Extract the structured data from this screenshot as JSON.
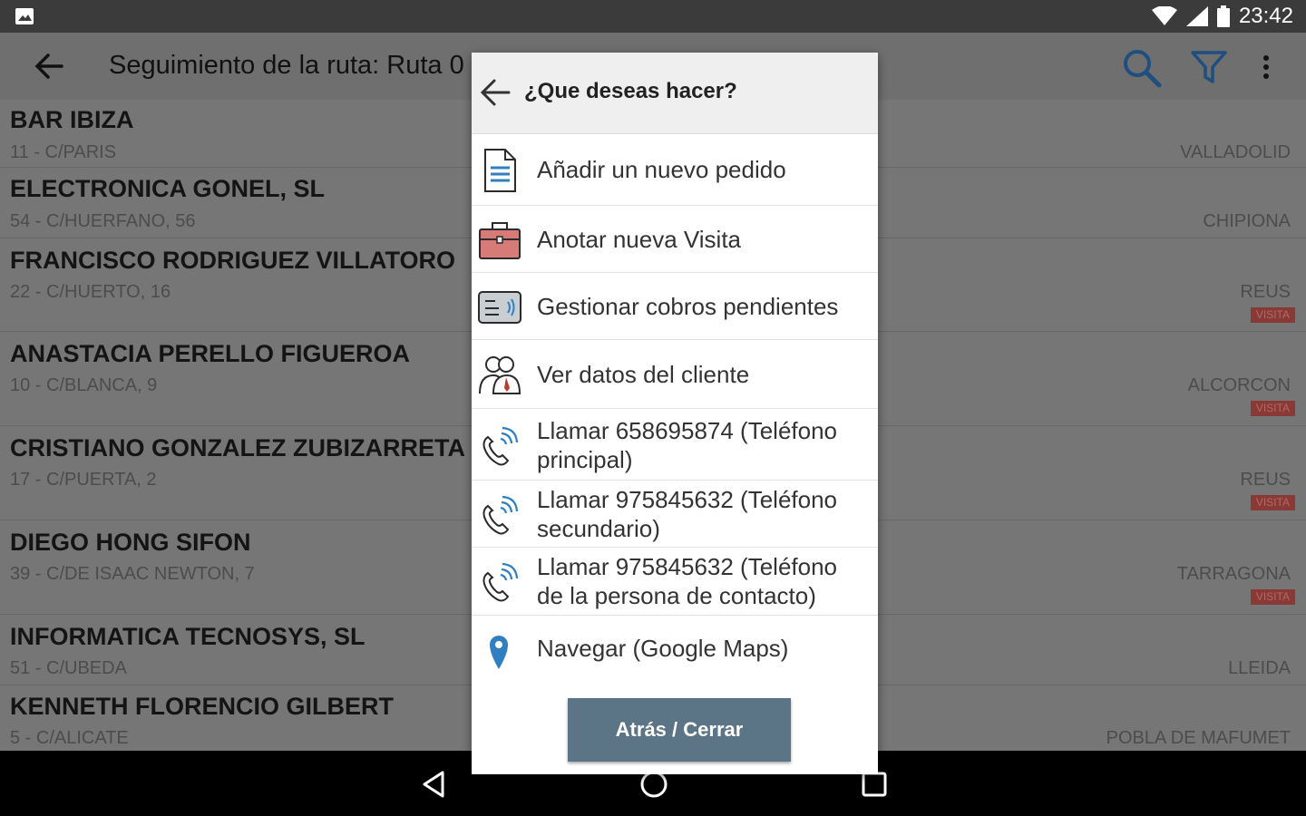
{
  "status_bar": {
    "time": "23:42"
  },
  "app_bar": {
    "title": "Seguimiento de la ruta: Ruta 0"
  },
  "customers": [
    {
      "name": "BAR IBIZA",
      "address": "11 - C/PARIS",
      "city": "VALLADOLID",
      "badge": ""
    },
    {
      "name": "ELECTRONICA GONEL, SL",
      "address": "54 - C/HUERFANO, 56",
      "city": "CHIPIONA",
      "badge": ""
    },
    {
      "name": "FRANCISCO RODRIGUEZ VILLATORO",
      "address": "22 - C/HUERTO, 16",
      "city": "REUS",
      "badge": "VISITA"
    },
    {
      "name": "ANASTACIA PERELLO FIGUEROA",
      "address": "10 - C/BLANCA, 9",
      "city": "ALCORCON",
      "badge": "VISITA"
    },
    {
      "name": "CRISTIANO GONZALEZ  ZUBIZARRETA",
      "address": "17 - C/PUERTA, 2",
      "city": "REUS",
      "badge": "VISITA"
    },
    {
      "name": "DIEGO HONG SIFON",
      "address": "39 - C/DE ISAAC NEWTON, 7",
      "city": "TARRAGONA",
      "badge": "VISITA"
    },
    {
      "name": "INFORMATICA TECNOSYS, SL",
      "address": "51 - C/UBEDA",
      "city": "LLEIDA",
      "badge": ""
    },
    {
      "name": "KENNETH FLORENCIO GILBERT",
      "address": "5 - C/ALICATE",
      "city": "POBLA DE MAFUMET",
      "badge": ""
    }
  ],
  "dialog": {
    "title": "¿Que deseas hacer?",
    "options": [
      {
        "label": "Añadir un nuevo pedido",
        "icon": "document-icon"
      },
      {
        "label": "Anotar nueva Visita",
        "icon": "briefcase-icon"
      },
      {
        "label": "Gestionar cobros pendientes",
        "icon": "payment-card-icon"
      },
      {
        "label": "Ver datos del cliente",
        "icon": "people-icon"
      },
      {
        "label": "Llamar 658695874 (Teléfono principal)",
        "icon": "phone-call-icon"
      },
      {
        "label": "Llamar 975845632 (Teléfono secundario)",
        "icon": "phone-call-icon"
      },
      {
        "label": "Llamar 975845632 (Teléfono de la persona de contacto)",
        "icon": "phone-call-icon"
      },
      {
        "label": "Navegar (Google Maps)",
        "icon": "map-pin-icon"
      }
    ],
    "close_label": "Atrás / Cerrar"
  },
  "colors": {
    "dialog_button": "#5b7587",
    "badge": "#8a3a36",
    "icon_blue": "#2f7fc1"
  }
}
